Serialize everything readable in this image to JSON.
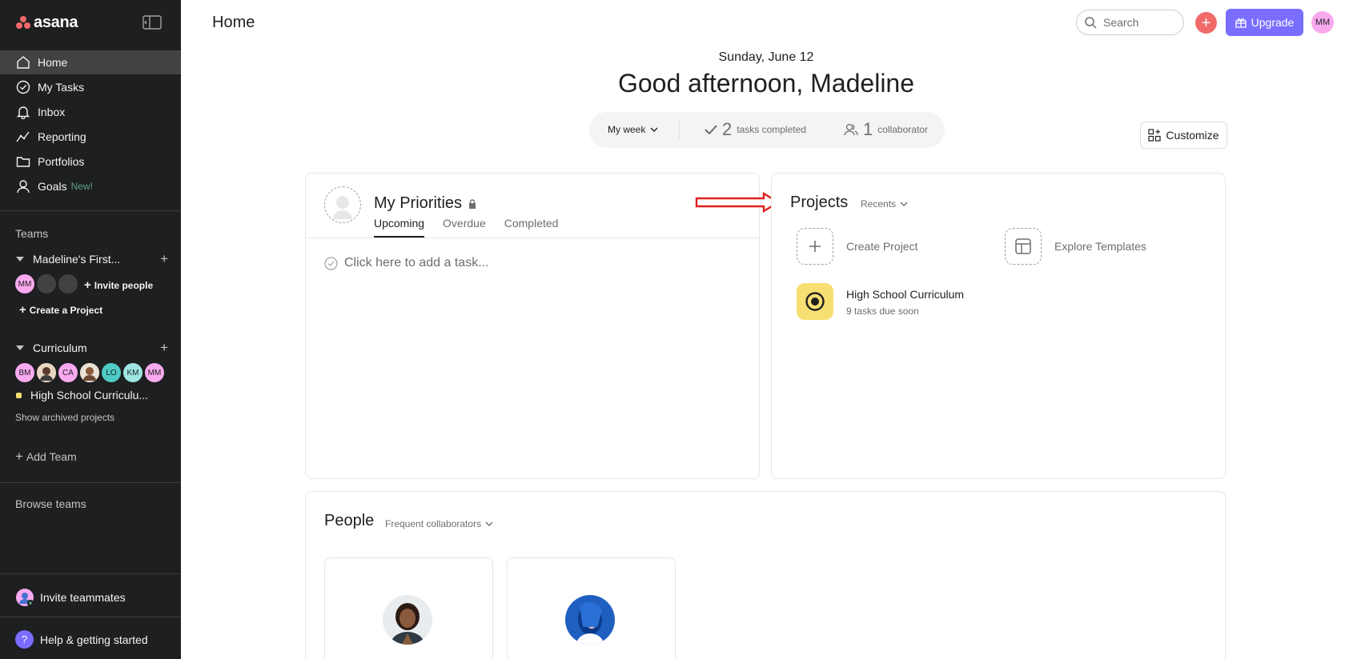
{
  "brand": {
    "name": "asana"
  },
  "sidebar": {
    "nav": [
      {
        "label": "Home",
        "icon": "home-icon"
      },
      {
        "label": "My Tasks",
        "icon": "check-circle-icon"
      },
      {
        "label": "Inbox",
        "icon": "bell-icon"
      },
      {
        "label": "Reporting",
        "icon": "chart-line-icon"
      },
      {
        "label": "Portfolios",
        "icon": "folder-icon"
      },
      {
        "label": "Goals",
        "icon": "person-icon",
        "badge": "New!"
      }
    ],
    "teams_label": "Teams",
    "teams": [
      {
        "name": "Madeline's First...",
        "members": [
          "MM",
          "",
          ""
        ],
        "invite_label": "Invite people",
        "create_label": "Create a Project"
      },
      {
        "name": "Curriculum",
        "members": [
          "BM",
          "",
          "CA",
          "",
          "LO",
          "KM",
          "MM"
        ]
      }
    ],
    "project": "High School Curriculu...",
    "archived_label": "Show archived projects",
    "add_team_label": "Add Team",
    "browse_label": "Browse teams",
    "invite_teammates_label": "Invite teammates",
    "help_label": "Help & getting started"
  },
  "header": {
    "title": "Home",
    "search_placeholder": "Search",
    "upgrade_label": "Upgrade",
    "user_initials": "MM"
  },
  "greeting": {
    "date": "Sunday, June 12",
    "text": "Good afternoon, Madeline"
  },
  "stats": {
    "range_label": "My week",
    "tasks_completed": "2",
    "tasks_completed_label": "tasks completed",
    "collaborators": "1",
    "collaborators_label": "collaborator"
  },
  "customize_label": "Customize",
  "priorities": {
    "title": "My Priorities",
    "tabs": [
      "Upcoming",
      "Overdue",
      "Completed"
    ],
    "add_task_placeholder": "Click here to add a task..."
  },
  "projects": {
    "title": "Projects",
    "filter": "Recents",
    "create_label": "Create Project",
    "templates_label": "Explore Templates",
    "items": [
      {
        "name": "High School Curriculum",
        "subtitle": "9 tasks due soon"
      }
    ]
  },
  "people": {
    "title": "People",
    "filter": "Frequent collaborators"
  },
  "colors": {
    "sidebar_bg": "#1e1f21",
    "accent_red": "#f06a6a",
    "upgrade_purple": "#796eff",
    "project_yellow": "#f8df72"
  }
}
